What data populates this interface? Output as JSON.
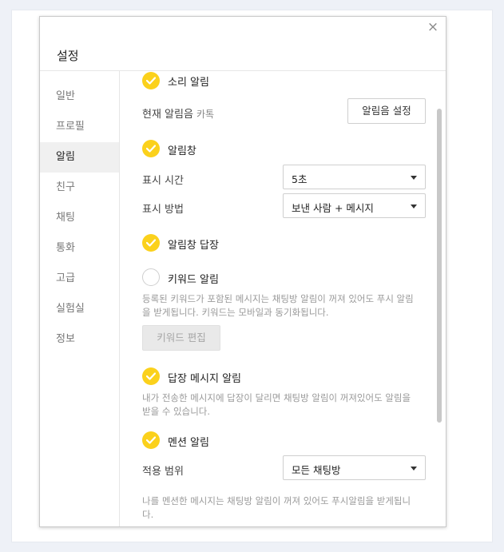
{
  "dialog": {
    "title": "설정",
    "close_label": "×"
  },
  "sidebar": {
    "items": [
      {
        "label": "일반"
      },
      {
        "label": "프로필"
      },
      {
        "label": "알림"
      },
      {
        "label": "친구"
      },
      {
        "label": "채팅"
      },
      {
        "label": "통화"
      },
      {
        "label": "고급"
      },
      {
        "label": "실험실"
      },
      {
        "label": "정보"
      }
    ],
    "active": "알림"
  },
  "content": {
    "sound_alert": {
      "label": "소리 알림",
      "checked": true,
      "current_sound_label": "현재 알림음",
      "current_sound_value": "카톡",
      "settings_button": "알림음 설정"
    },
    "alert_window": {
      "label": "알림창",
      "checked": true,
      "display_time_label": "표시 시간",
      "display_time_value": "5초",
      "display_method_label": "표시 방법",
      "display_method_value": "보낸 사람 + 메시지"
    },
    "alert_reply": {
      "label": "알림창 답장",
      "checked": true
    },
    "keyword_alert": {
      "label": "키워드 알림",
      "checked": false,
      "description": "등록된 키워드가 포함된 메시지는 채팅방 알림이 꺼져 있어도 푸시 알림을 받게됩니다. 키워드는 모바일과 동기화됩니다.",
      "edit_button": "키워드 편집"
    },
    "reply_message_alert": {
      "label": "답장 메시지 알림",
      "checked": true,
      "description": "내가 전송한 메시지에 답장이 달리면 채팅방 알림이 꺼져있어도 알림을 받을 수 있습니다."
    },
    "mention_alert": {
      "label": "멘션 알림",
      "checked": true,
      "scope_label": "적용 범위",
      "scope_value": "모든 채팅방",
      "description": "나를 멘션한 메시지는 채팅방 알림이 꺼져 있어도 푸시알림을 받게됩니다."
    }
  },
  "colors": {
    "accent": "#fbd11c",
    "active_nav_bg": "#f0f0f0",
    "muted_text": "#9a9a9a"
  }
}
